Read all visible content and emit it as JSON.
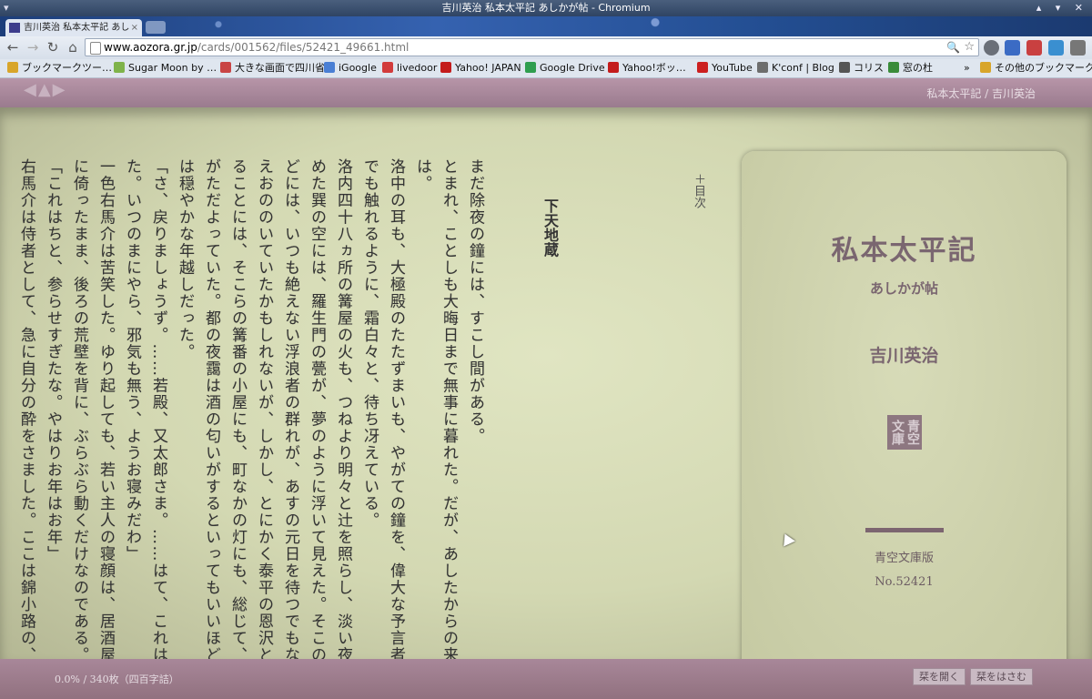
{
  "window": {
    "title": "吉川英治 私本太平記 あしかが帖 - Chromium",
    "menu_icon": "▾",
    "controls": "▴ ▾ ✕"
  },
  "tab": {
    "label": "吉川英治 私本太平記 あし",
    "close": "×"
  },
  "toolbar": {
    "back": "←",
    "forward": "→",
    "reload": "↻",
    "home": "⌂",
    "url_host": "www.aozora.gr.jp",
    "url_path": "/cards/001562/files/52421_49661.html",
    "zoom": "🔍",
    "star": "☆"
  },
  "bookmarks": [
    {
      "label": "ブックマークツー…",
      "color": "#d8a52a"
    },
    {
      "label": "Sugar Moon by …",
      "color": "#7fb34a"
    },
    {
      "label": "大きな画面で四川省",
      "color": "#c94545"
    },
    {
      "label": "iGoogle",
      "color": "#4a7fd4"
    },
    {
      "label": "livedoor",
      "color": "#d23b3b"
    },
    {
      "label": "Yahoo! JAPAN",
      "color": "#c41c1c"
    },
    {
      "label": "Google Drive",
      "color": "#2f9e4f"
    },
    {
      "label": "Yahoo!ボッ…",
      "color": "#c41c1c"
    },
    {
      "label": "YouTube",
      "color": "#cc1f1f"
    },
    {
      "label": "K'conf | Blog",
      "color": "#6d6d6d"
    },
    {
      "label": "コリス",
      "color": "#555"
    },
    {
      "label": "窓の杜",
      "color": "#3a8c3a"
    }
  ],
  "bookmarks_more": "»",
  "bookmarks_other": "その他のブックマーク",
  "reader": {
    "nav_arrows": "◀▲▶",
    "page_info": "私本太平記 / 吉川英治",
    "chapter_title": "下天地蔵",
    "toc_label": "＋目次",
    "paragraphs": [
      "まだ除夜の鐘には、すこし間がある。",
      "とまれ、ことしも大晦日まで無事に暮れた。だが、あしたからの来る年は。",
      "洛中の耳も、大極殿のたたずまいも、やがての鐘を、偉大な予言者の声にでも触れるように、霜白々と、待ち冴えている。",
      "洛内四十八ヵ所の篝屋の火も、つねより明々と辻を照らし、淡い夜靄をこめた巽の空には、羅生門の甍が、夢のように浮いて見えた。そこの楼上などには、いつも絶えない浮浪者の群れが、あすの元日を待つでもなく、飢えおののいていたかもしれないが、しかし、とにかく泰平の恩沢ともいえることには、そこらの篝番の小屋にも、町なかの灯にも、総じて、酒の香がただよっていた。都の夜靄は酒の匂いがするといってもいいほど、まずは穏やかな年越しだった。",
      "「さ、戻りましょうず。……若殿、又太郎さま。……はて、これは困った。いつのまにやら、邪気も無う、ようお寝みだわ」",
      "一色右馬介は苦笑した。ゆり起しても、若い主人の寝顔は、居酒屋の床几に倚ったまま、後ろの荒壁を背に、ぶらぶら動くだけなのである。",
      "「これはちと、参らせすぎたな。やはりお年はお年」",
      "右馬介は侍者として、急に自分の酔をさました。ここは錦小路の、俗"
    ],
    "progress": "0.0% / 340枚（四百字詰）",
    "btn_open": "栞を開く",
    "btn_insert": "栞をはさむ"
  },
  "cover": {
    "title": "私本太平記",
    "subtitle": "あしかが帖",
    "author": "吉川英治",
    "seal_col1": "青空",
    "seal_col2": "文庫",
    "edition": "青空文庫版",
    "number": "No.52421"
  }
}
